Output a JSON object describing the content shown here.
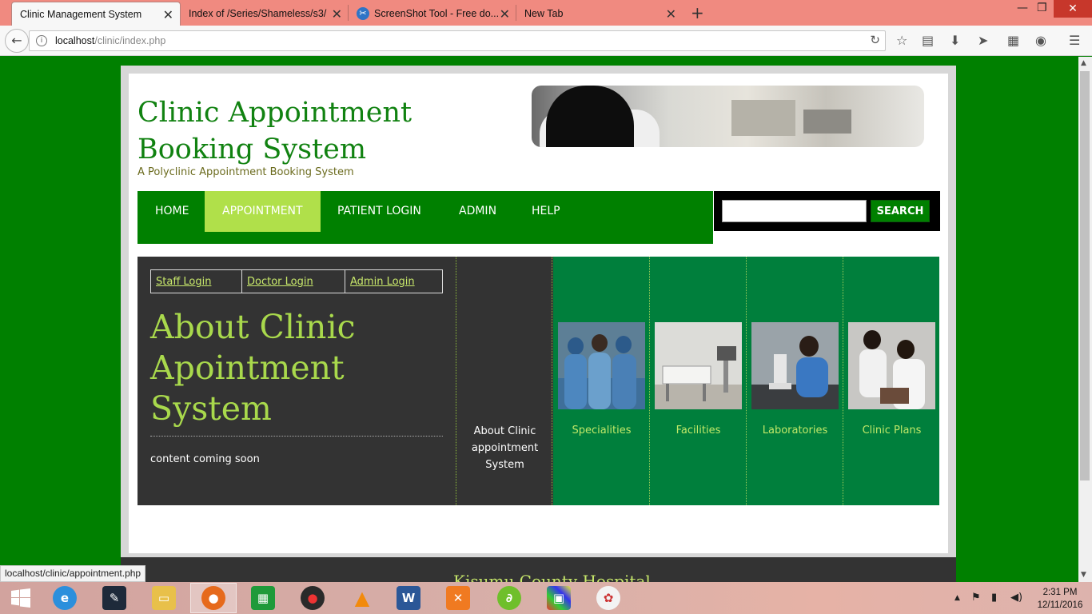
{
  "browser": {
    "tabs": [
      {
        "title": "Clinic Management System",
        "active": true
      },
      {
        "title": "Index of /Series/Shameless/s3/",
        "active": false
      },
      {
        "title": "ScreenShot Tool - Free do...",
        "active": false
      },
      {
        "title": "New Tab",
        "active": false
      }
    ],
    "url_host": "localhost",
    "url_path": "/clinic/index.php",
    "status_url": "localhost/clinic/appointment.php"
  },
  "site": {
    "title": "Clinic Appointment Booking System",
    "tagline": "A Polyclinic Appointment Booking System",
    "menu": [
      "HOME",
      "APPOINTMENT",
      "PATIENT LOGIN",
      "ADMIN",
      "HELP"
    ],
    "active_menu": "APPOINTMENT",
    "search_label": "SEARCH",
    "search_value": "",
    "login_links": [
      "Staff Login",
      "Doctor Login",
      "Admin Login"
    ],
    "about_heading": "About Clinic Apointment System",
    "about_text": "content coming soon",
    "middle_caption": "About Clinic appointment System",
    "features": [
      "Specialities",
      "Facilities",
      "Laboratories",
      "Clinic Plans"
    ],
    "footer_title": "Kisumu County Hospital"
  },
  "colors": {
    "page_bg": "#008000",
    "title_green": "#118211",
    "menu_active": "#b0e04a",
    "content_dark": "#333333",
    "feature_panel": "#007f3c",
    "link_lime": "#c8e86b"
  },
  "taskbar": {
    "apps": [
      "internet-explorer",
      "pen-app",
      "file-explorer",
      "firefox",
      "store",
      "media-app",
      "vlc",
      "word",
      "xampp",
      "dreamweaver",
      "color-app",
      "paint"
    ],
    "time": "2:31 PM",
    "date": "12/11/2016"
  }
}
